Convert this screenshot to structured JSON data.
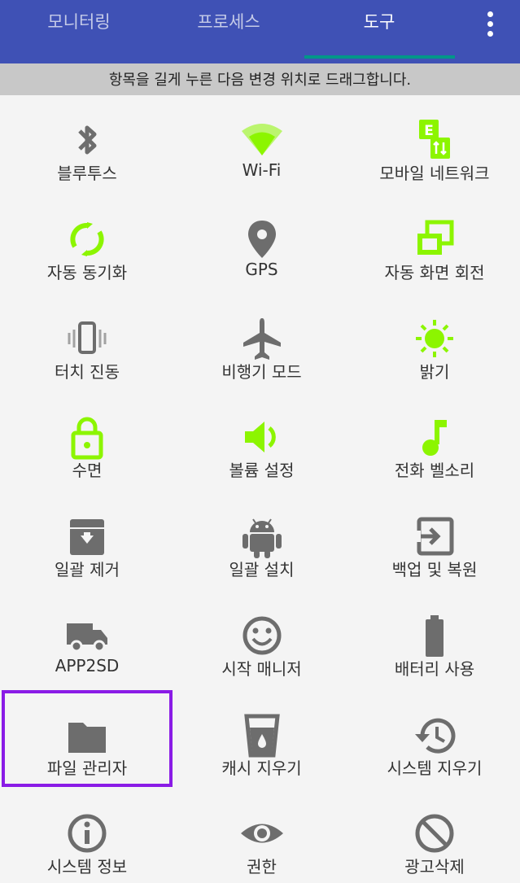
{
  "tabs": [
    "모니터링",
    "프로세스",
    "도구"
  ],
  "active_tab": 2,
  "hint": "항목을 길게 누른 다음 변경 위치로 드래그합니다.",
  "colors": {
    "green": "#8cf500",
    "gray": "#6d6d6d",
    "header": "#3f51b5",
    "indicator": "#009688",
    "selection": "#8a1be6"
  },
  "items": [
    {
      "label": "블루투스",
      "icon": "bluetooth-icon"
    },
    {
      "label": "Wi-Fi",
      "icon": "wifi-icon"
    },
    {
      "label": "모바일 네트워크",
      "icon": "mobile-network-icon"
    },
    {
      "label": "자동 동기화",
      "icon": "sync-icon"
    },
    {
      "label": "GPS",
      "icon": "location-pin-icon"
    },
    {
      "label": "자동 화면 회전",
      "icon": "screen-rotation-icon"
    },
    {
      "label": "터치 진동",
      "icon": "vibration-icon"
    },
    {
      "label": "비행기 모드",
      "icon": "airplane-icon"
    },
    {
      "label": "밝기",
      "icon": "brightness-icon"
    },
    {
      "label": "수면",
      "icon": "lock-icon"
    },
    {
      "label": "볼륨 설정",
      "icon": "volume-icon"
    },
    {
      "label": "전화 벨소리",
      "icon": "music-note-icon"
    },
    {
      "label": "일괄 제거",
      "icon": "archive-icon"
    },
    {
      "label": "일괄 설치",
      "icon": "android-icon"
    },
    {
      "label": "백업 및 복원",
      "icon": "backup-icon"
    },
    {
      "label": "APP2SD",
      "icon": "truck-icon"
    },
    {
      "label": "시작 매니저",
      "icon": "smiley-icon"
    },
    {
      "label": "배터리 사용",
      "icon": "battery-icon"
    },
    {
      "label": "파일 관리자",
      "icon": "folder-icon"
    },
    {
      "label": "캐시 지우기",
      "icon": "cup-icon"
    },
    {
      "label": "시스템 지우기",
      "icon": "history-icon"
    },
    {
      "label": "시스템 정보",
      "icon": "info-icon"
    },
    {
      "label": "권한",
      "icon": "eye-icon"
    },
    {
      "label": "광고삭제",
      "icon": "block-icon"
    }
  ]
}
